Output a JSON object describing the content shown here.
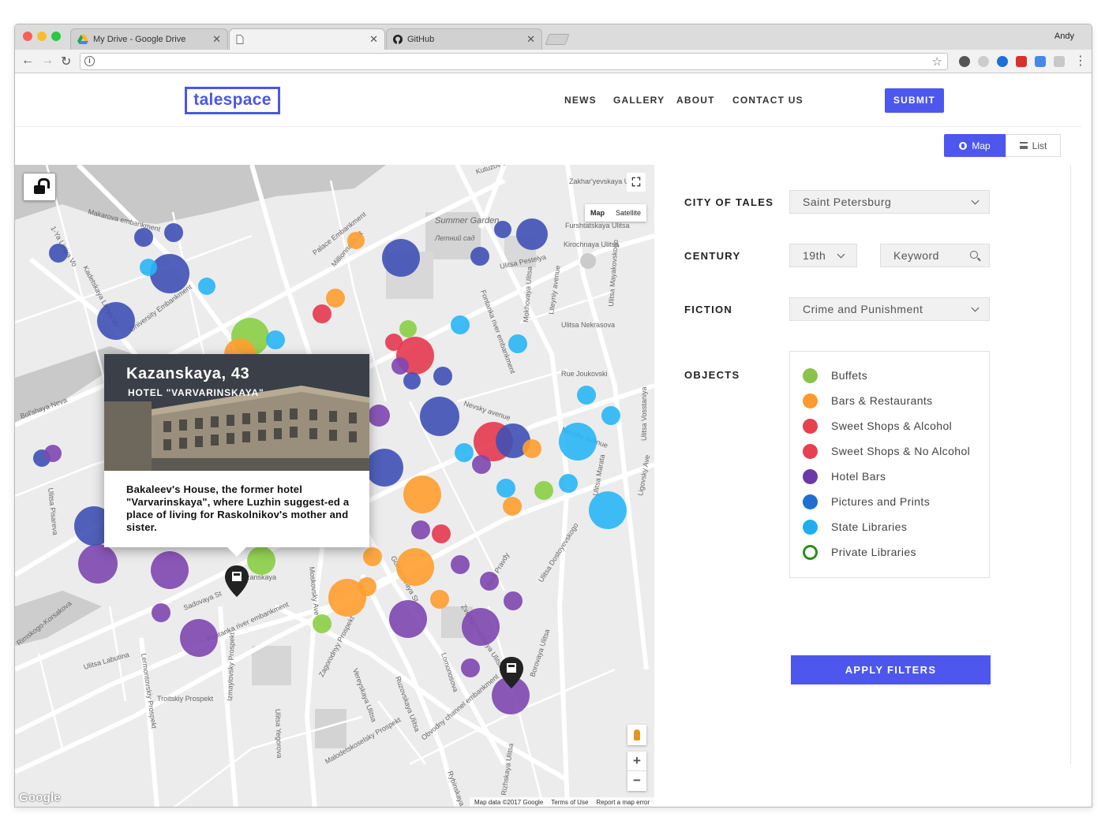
{
  "browser": {
    "tabs": [
      {
        "title": "My Drive - Google Drive",
        "icon": "drive-icon"
      },
      {
        "title": "",
        "icon": "page-icon"
      },
      {
        "title": "GitHub",
        "icon": "github-icon"
      }
    ],
    "profile_name": "Andy",
    "url": ""
  },
  "header": {
    "logo": "talespace",
    "nav": [
      "NEWS",
      "GALLERY",
      "ABOUT",
      "CONTACT US"
    ],
    "submit_label": "SUBMIT"
  },
  "view_toggle": {
    "map_label": "Map",
    "list_label": "List",
    "active": "Map"
  },
  "map": {
    "map_type_options": [
      "Map",
      "Satellite"
    ],
    "map_type_active": "Map",
    "street_labels": [
      "Makarova embankment",
      "1-Ya Liniya Vo",
      "Kadetskaya Liniya Vo",
      "University Embankment",
      "Summer Garden",
      "Летний сад",
      "Palace Embankment",
      "Millionnaya St",
      "Ulitsa Pestelya",
      "Kirochnaya Ulitsa",
      "Furshtatskaya Ulitsa",
      "Zakhar'yevskaya Ul",
      "Ulitsa Nekrasova",
      "Rue Joukovski",
      "Nevsky avenue",
      "Nevsky avenue",
      "Fontanka river embankment",
      "Bol'shaya Neva",
      "Sadovaya St",
      "Fontanka river embankment",
      "Troitskiy Prospekt",
      "Lermontovskiy Prospekt",
      "Izmaylovsky Prospekt",
      "Moskovsky Ave",
      "Zagorodnyy Prospekt",
      "Obvodny channel embankment",
      "Ulitsa Marata",
      "Ligovsky Ave",
      "Ulitsa Pravdy",
      "Ulitsa Dostoyevskogo",
      "Borovaya Ulitsa",
      "Rizhskaya Ulitsa",
      "Ulitsa Labutina",
      "Rimskogo-Korsakova",
      "Ulitsa Pisareva",
      "Ulitsa Vosstaniya",
      "Kutuzov emb",
      "Liteyniy avenue",
      "Mokhovaya Ulitsa",
      "Ulitsa Mayakovskogo",
      "Lomonosova",
      "Gorokhovaya St",
      "Kazanskaya",
      "Zvenigorodskaya Ulitsa",
      "Vereyskaya Ulitsa",
      "Ruzovskaya Ulitsa",
      "Malodetskoselsky Prospekt",
      "Ulitsa Yegorova",
      "Rybinskaya"
    ],
    "circles": [
      {
        "category": "Pictures and Prints",
        "color": "#3f51b5",
        "size": "m"
      },
      {
        "category": "State Libraries",
        "color": "#29b6f6",
        "size": "s"
      },
      {
        "category": "Sweet Shops & Alcohol",
        "color": "#e53950",
        "size": "m"
      },
      {
        "category": "Bars & Restaurants",
        "color": "#ff9f30",
        "size": "m"
      },
      {
        "category": "Hotel Bars",
        "color": "#7e47b0",
        "size": "m"
      },
      {
        "category": "Buffets",
        "color": "#8bcf45",
        "size": "s"
      }
    ],
    "attribution": [
      "Map data ©2017 Google",
      "Terms of Use",
      "Report a map error"
    ],
    "google_logo": "Google"
  },
  "popup": {
    "title": "Kazanskaya, 43",
    "subtitle": "HOTEL \"VARVARINSKAYA\"",
    "description": "Bakaleev's House, the former hotel \"Varvarinskaya\", where Luzhin suggest-ed a place of living for Raskolnikov's mother and sister."
  },
  "filters": {
    "city_label": "CITY OF TALES",
    "city_value": "Saint Petersburg",
    "century_label": "CENTURY",
    "century_value": "19th",
    "keyword_placeholder": "Keyword",
    "fiction_label": "FICTION",
    "fiction_value": "Crime and Punishment",
    "objects_label": "OBJECTS",
    "objects": [
      {
        "label": "Buffets",
        "color": "#8bc34a",
        "style": "filled"
      },
      {
        "label": "Bars & Restaurants",
        "color": "#ff9a2e",
        "style": "filled"
      },
      {
        "label": "Sweet Shops & Alcohol",
        "color": "#e8404f",
        "style": "filled"
      },
      {
        "label": "Sweet Shops & No Alcohol",
        "color": "#e8404f",
        "style": "filled"
      },
      {
        "label": "Hotel Bars",
        "color": "#6a3aa6",
        "style": "filled"
      },
      {
        "label": "Pictures and Prints",
        "color": "#1e6fd0",
        "style": "filled"
      },
      {
        "label": "State Libraries",
        "color": "#1eaef0",
        "style": "filled"
      },
      {
        "label": "Private Libraries",
        "color": "#2e8b20",
        "style": "ring"
      }
    ],
    "apply_label": "APPLY FILTERS"
  }
}
